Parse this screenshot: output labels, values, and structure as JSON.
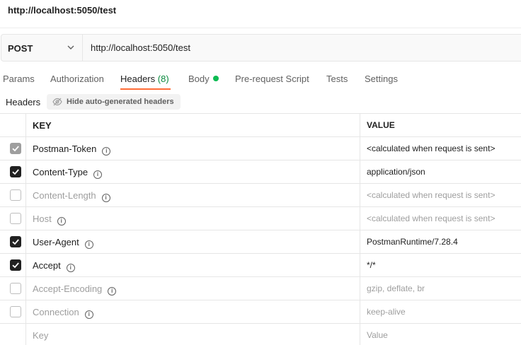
{
  "window_title": "http://localhost:5050/test",
  "request": {
    "method": "POST",
    "url": "http://localhost:5050/test"
  },
  "tabs": [
    {
      "label": "Params"
    },
    {
      "label": "Authorization"
    },
    {
      "label": "Headers",
      "count": "(8)"
    },
    {
      "label": "Body"
    },
    {
      "label": "Pre-request Script"
    },
    {
      "label": "Tests"
    },
    {
      "label": "Settings"
    }
  ],
  "headers_section": {
    "label": "Headers",
    "hide_button": "Hide auto-generated headers",
    "columns": {
      "key": "KEY",
      "value": "VALUE"
    },
    "rows": [
      {
        "key": "Postman-Token",
        "value": "<calculated when request is sent>",
        "checked": "locked"
      },
      {
        "key": "Content-Type",
        "value": "application/json",
        "checked": "on"
      },
      {
        "key": "Content-Length",
        "value": "<calculated when request is sent>",
        "checked": "off"
      },
      {
        "key": "Host",
        "value": "<calculated when request is sent>",
        "checked": "off"
      },
      {
        "key": "User-Agent",
        "value": "PostmanRuntime/7.28.4",
        "checked": "on"
      },
      {
        "key": "Accept",
        "value": "*/*",
        "checked": "on"
      },
      {
        "key": "Accept-Encoding",
        "value": "gzip, deflate, br",
        "checked": "off"
      },
      {
        "key": "Connection",
        "value": "keep-alive",
        "checked": "off"
      }
    ],
    "new_row": {
      "key_placeholder": "Key",
      "value_placeholder": "Value"
    }
  },
  "colors": {
    "accent": "#ff6c37",
    "count": "#0b8a3e",
    "body_dot": "#0cbb52"
  }
}
